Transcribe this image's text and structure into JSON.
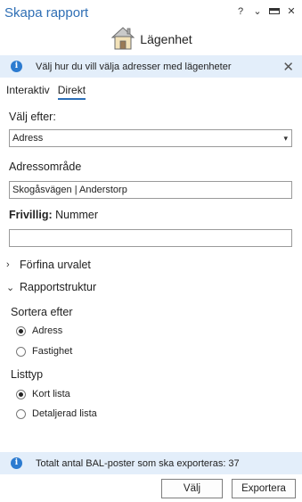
{
  "window": {
    "title": "Skapa rapport",
    "controls": [
      "?",
      "⌄",
      "□",
      "✕"
    ]
  },
  "header": {
    "icon": "house-icon",
    "label": "Lägenhet"
  },
  "info_top": {
    "text": "Välj hur du vill välja adresser med lägenheter",
    "close": "✕"
  },
  "tabs": [
    {
      "label": "Interaktiv",
      "active": false
    },
    {
      "label": "Direkt",
      "active": true
    }
  ],
  "form": {
    "choose_by_label": "Välj efter:",
    "choose_by_value": "Adress",
    "address_area_label": "Adressområde",
    "address_area_value": "Skogåsvägen | Anderstorp",
    "optional_prefix": "Frivillig:",
    "optional_label": "Nummer",
    "number_value": ""
  },
  "sections": {
    "refine": {
      "label": "Förfina urvalet",
      "expanded": false
    },
    "structure": {
      "label": "Rapportstruktur",
      "expanded": true
    }
  },
  "sort": {
    "label": "Sortera efter",
    "options": [
      {
        "label": "Adress",
        "selected": true
      },
      {
        "label": "Fastighet",
        "selected": false
      }
    ]
  },
  "listtype": {
    "label": "Listtyp",
    "options": [
      {
        "label": "Kort lista",
        "selected": true
      },
      {
        "label": "Detaljerad lista",
        "selected": false
      }
    ]
  },
  "info_bottom": {
    "text": "Totalt antal BAL-poster som ska exporteras: 37"
  },
  "buttons": {
    "choose": "Välj",
    "export": "Exportera"
  },
  "colors": {
    "accent": "#2f6fb5",
    "info_bg": "#e3eefa",
    "info_icon": "#2c7bd0"
  }
}
